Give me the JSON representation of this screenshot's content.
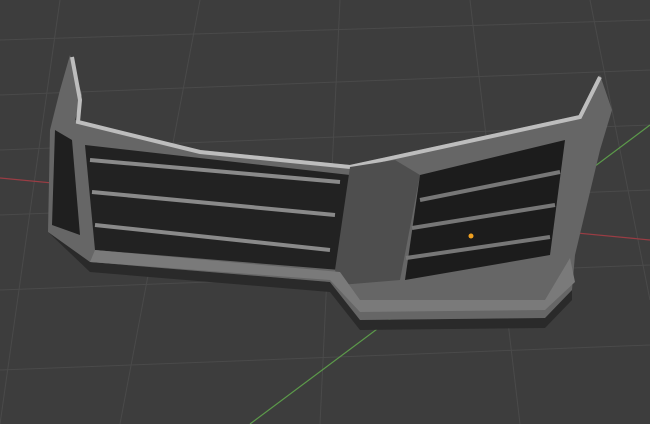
{
  "viewport": {
    "background_color": "#3d3d3d",
    "grid_color": "#4a4a4a",
    "x_axis_color": "#9a3d44",
    "y_axis_color": "#5c9a4a",
    "origin_marker_color": "#f0a020"
  },
  "model": {
    "icon": "car-front-bumper-mesh",
    "body_color": "#6e6e6e",
    "highlight_color": "#b8b8b8",
    "dark_color": "#1c1c1c"
  }
}
